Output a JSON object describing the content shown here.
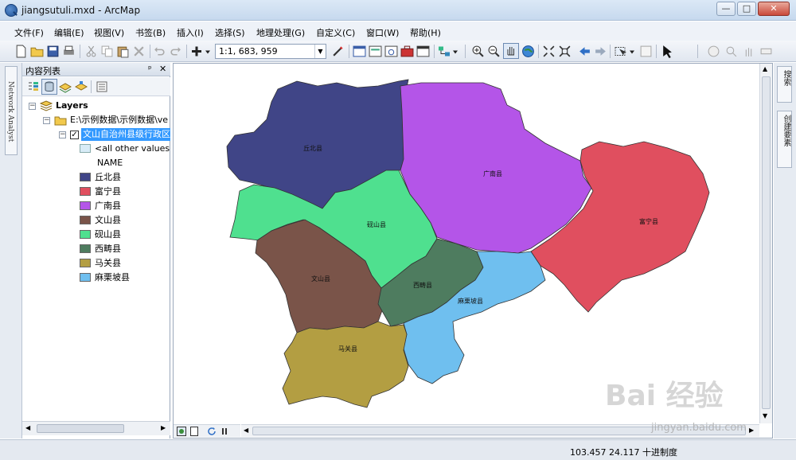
{
  "window": {
    "title": "jiangsutuli.mxd - ArcMap",
    "minimize": "—",
    "maximize": "□",
    "close": "✕"
  },
  "menu": [
    "文件(F)",
    "编辑(E)",
    "视图(V)",
    "书签(B)",
    "插入(I)",
    "选择(S)",
    "地理处理(G)",
    "自定义(C)",
    "窗口(W)",
    "帮助(H)"
  ],
  "toolbar": {
    "scale": "1:1, 683, 959"
  },
  "left_strip": {
    "tab_label": "Network Analyst"
  },
  "toc": {
    "title": "内容列表",
    "pin": "ᵖ",
    "close": "✕",
    "layers_label": "Layers",
    "folder_label": "E:\\示例数据\\示例数据\\ve",
    "layer_label": "文山自治州县级行政区",
    "all_other_values": "<all other values>",
    "field_name": "NAME",
    "legend": [
      {
        "label": "丘北县",
        "color": "#404587"
      },
      {
        "label": "富宁县",
        "color": "#e04f5f"
      },
      {
        "label": "广南县",
        "color": "#b455e8"
      },
      {
        "label": "文山县",
        "color": "#7a5449"
      },
      {
        "label": "砚山县",
        "color": "#4fe08f"
      },
      {
        "label": "西畴县",
        "color": "#4e7c5f"
      },
      {
        "label": "马关县",
        "color": "#b39e42"
      },
      {
        "label": "麻栗坡县",
        "color": "#6fbfef"
      }
    ]
  },
  "map": {
    "labels": {
      "qiubei": "丘北县",
      "guangnan": "广南县",
      "funing": "富宁县",
      "yanshan": "砚山县",
      "wenshan": "文山县",
      "xichou": "西畴县",
      "malipo": "麻栗坡县",
      "maguan": "马关县"
    }
  },
  "right_strip": {
    "tab1": "搜索",
    "tab2": "创建要素"
  },
  "status": {
    "coords": "103.457  24.117 十进制度"
  },
  "watermark": {
    "brand": "Bai 经验",
    "url": "jingyan.baidu.com"
  }
}
